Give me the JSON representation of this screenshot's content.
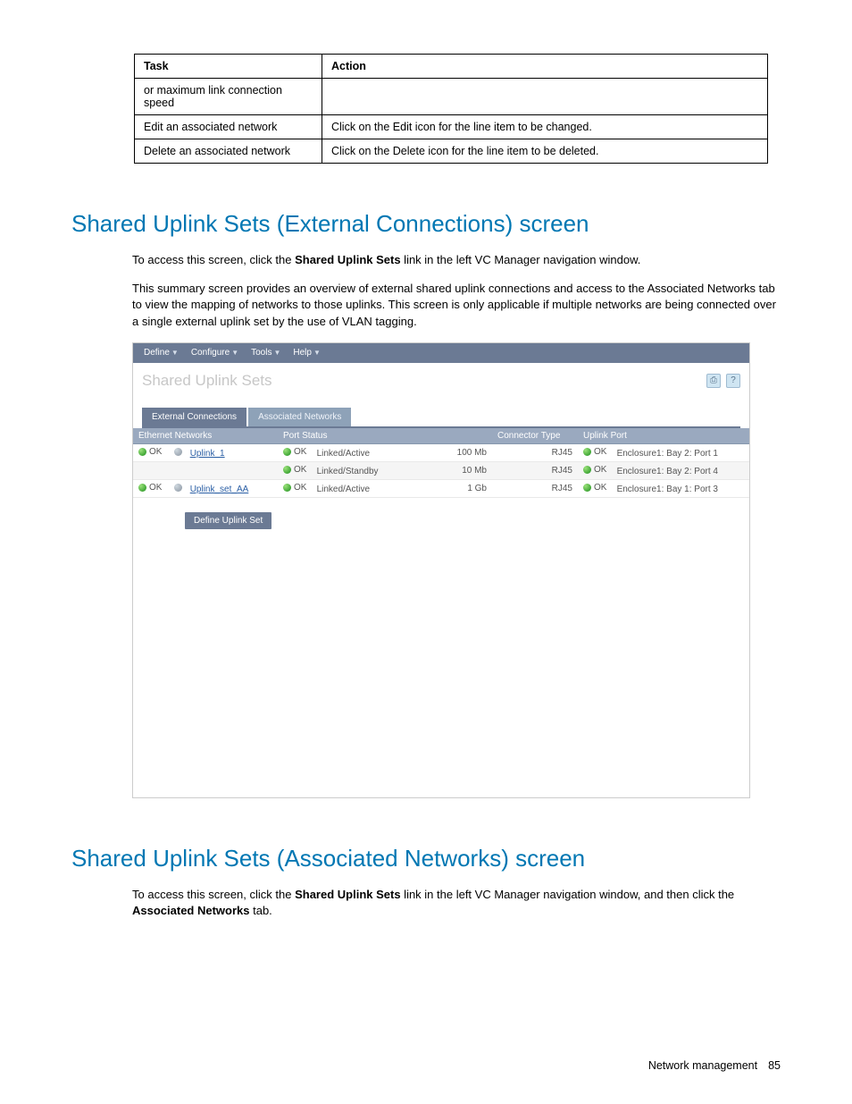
{
  "table": {
    "headers": {
      "task": "Task",
      "action": "Action"
    },
    "rows": [
      {
        "task": "or maximum link connection speed",
        "action": ""
      },
      {
        "task": "Edit an associated network",
        "action": "Click on the Edit icon for the line item to be changed."
      },
      {
        "task": "Delete an associated network",
        "action": "Click on the Delete icon for the line item to be deleted."
      }
    ]
  },
  "section1": {
    "title": "Shared Uplink Sets (External Connections) screen",
    "intro_prefix": "To access this screen, click the ",
    "intro_bold": "Shared Uplink Sets",
    "intro_suffix": " link in the left VC Manager navigation window.",
    "para2": "This summary screen provides an overview of external shared uplink connections and access to the Associated Networks tab to view the mapping of networks to those uplinks. This screen is only applicable if multiple networks are being connected over a single external uplink set by the use of VLAN tagging."
  },
  "screenshot": {
    "menu": [
      "Define",
      "Configure",
      "Tools",
      "Help"
    ],
    "title": "Shared Uplink Sets",
    "print_icon": "print-icon",
    "help_icon": "?",
    "tabs": {
      "active": "External Connections",
      "inactive": "Associated Networks"
    },
    "columns": {
      "eth": "Ethernet Networks",
      "port": "Port Status",
      "conn": "Connector Type",
      "up": "Uplink Port"
    },
    "ok": "OK",
    "rows": [
      {
        "name": "Uplink_1",
        "link": "Linked/Active",
        "speed": "100 Mb",
        "conn": "RJ45",
        "uplink": "Enclosure1: Bay 2: Port 1",
        "show_eth": true
      },
      {
        "name": "",
        "link": "Linked/Standby",
        "speed": "10 Mb",
        "conn": "RJ45",
        "uplink": "Enclosure1: Bay 2: Port 4",
        "show_eth": false
      },
      {
        "name": "Uplink_set_AA",
        "link": "Linked/Active",
        "speed": "1 Gb",
        "conn": "RJ45",
        "uplink": "Enclosure1: Bay 1: Port 3",
        "show_eth": true
      }
    ],
    "button": "Define Uplink Set"
  },
  "section2": {
    "title": "Shared Uplink Sets (Associated Networks) screen",
    "intro_prefix": "To access this screen, click the ",
    "intro_bold1": "Shared Uplink Sets",
    "intro_mid": " link in the left VC Manager navigation window, and then click the ",
    "intro_bold2": "Associated Networks",
    "intro_suffix": " tab."
  },
  "footer": {
    "label": "Network management",
    "page": "85"
  }
}
